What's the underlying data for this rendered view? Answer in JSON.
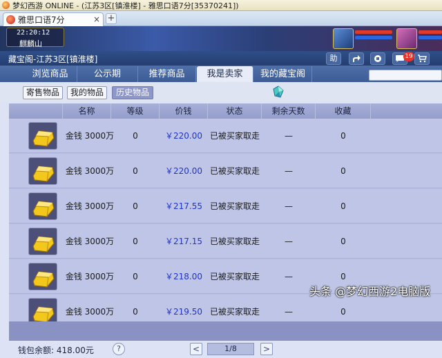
{
  "window": {
    "title": "梦幻西游 ONLINE - (江苏3区[镇淮楼] - 雅思口语7分[35370241])"
  },
  "browser_tab": {
    "label": "雅思口语7分",
    "close": "×",
    "new_tab": "+"
  },
  "game_hud": {
    "time": "22:20:12",
    "location": "麒麟山"
  },
  "panel": {
    "title": "藏宝阁-江苏3区[镇淮楼]",
    "tools": {
      "help_label": "助",
      "chat_badge": "19"
    },
    "nav_tabs": [
      {
        "label": "浏览商品",
        "active": false
      },
      {
        "label": "公示期",
        "active": false
      },
      {
        "label": "推荐商品",
        "active": false
      },
      {
        "label": "我是卖家",
        "active": true
      },
      {
        "label": "我的藏宝阁",
        "active": false
      }
    ],
    "sub_tabs": [
      {
        "label": "寄售物品",
        "active": false
      },
      {
        "label": "我的物品",
        "active": false
      },
      {
        "label": "历史物品",
        "active": true
      }
    ]
  },
  "table": {
    "columns": [
      "名称",
      "等级",
      "价钱",
      "状态",
      "剩余天数",
      "收藏"
    ],
    "rows": [
      {
        "name": "金钱  3000万两",
        "level": "0",
        "price": "￥220.00",
        "status": "已被买家取走",
        "days": "—",
        "fav": "0"
      },
      {
        "name": "金钱  3000万两",
        "level": "0",
        "price": "￥220.00",
        "status": "已被买家取走",
        "days": "—",
        "fav": "0"
      },
      {
        "name": "金钱  3000万两",
        "level": "0",
        "price": "￥217.55",
        "status": "已被买家取走",
        "days": "—",
        "fav": "0"
      },
      {
        "name": "金钱  3000万两",
        "level": "0",
        "price": "￥217.15",
        "status": "已被买家取走",
        "days": "—",
        "fav": "0"
      },
      {
        "name": "金钱  3000万两",
        "level": "0",
        "price": "￥218.00",
        "status": "已被买家取走",
        "days": "—",
        "fav": "0"
      },
      {
        "name": "金钱  3000万两",
        "level": "0",
        "price": "￥219.50",
        "status": "已被买家取走",
        "days": "—",
        "fav": "0"
      }
    ]
  },
  "footer": {
    "wallet": "钱包余额: 418.00元",
    "help": "?",
    "prev": "<",
    "page": "1/8",
    "next": ">"
  },
  "watermark": "头条 @梦幻西游2电脑版",
  "colors": {
    "price": "#1f34c8",
    "header": "#2f4e88",
    "active_subtab": "#8d97c9"
  }
}
